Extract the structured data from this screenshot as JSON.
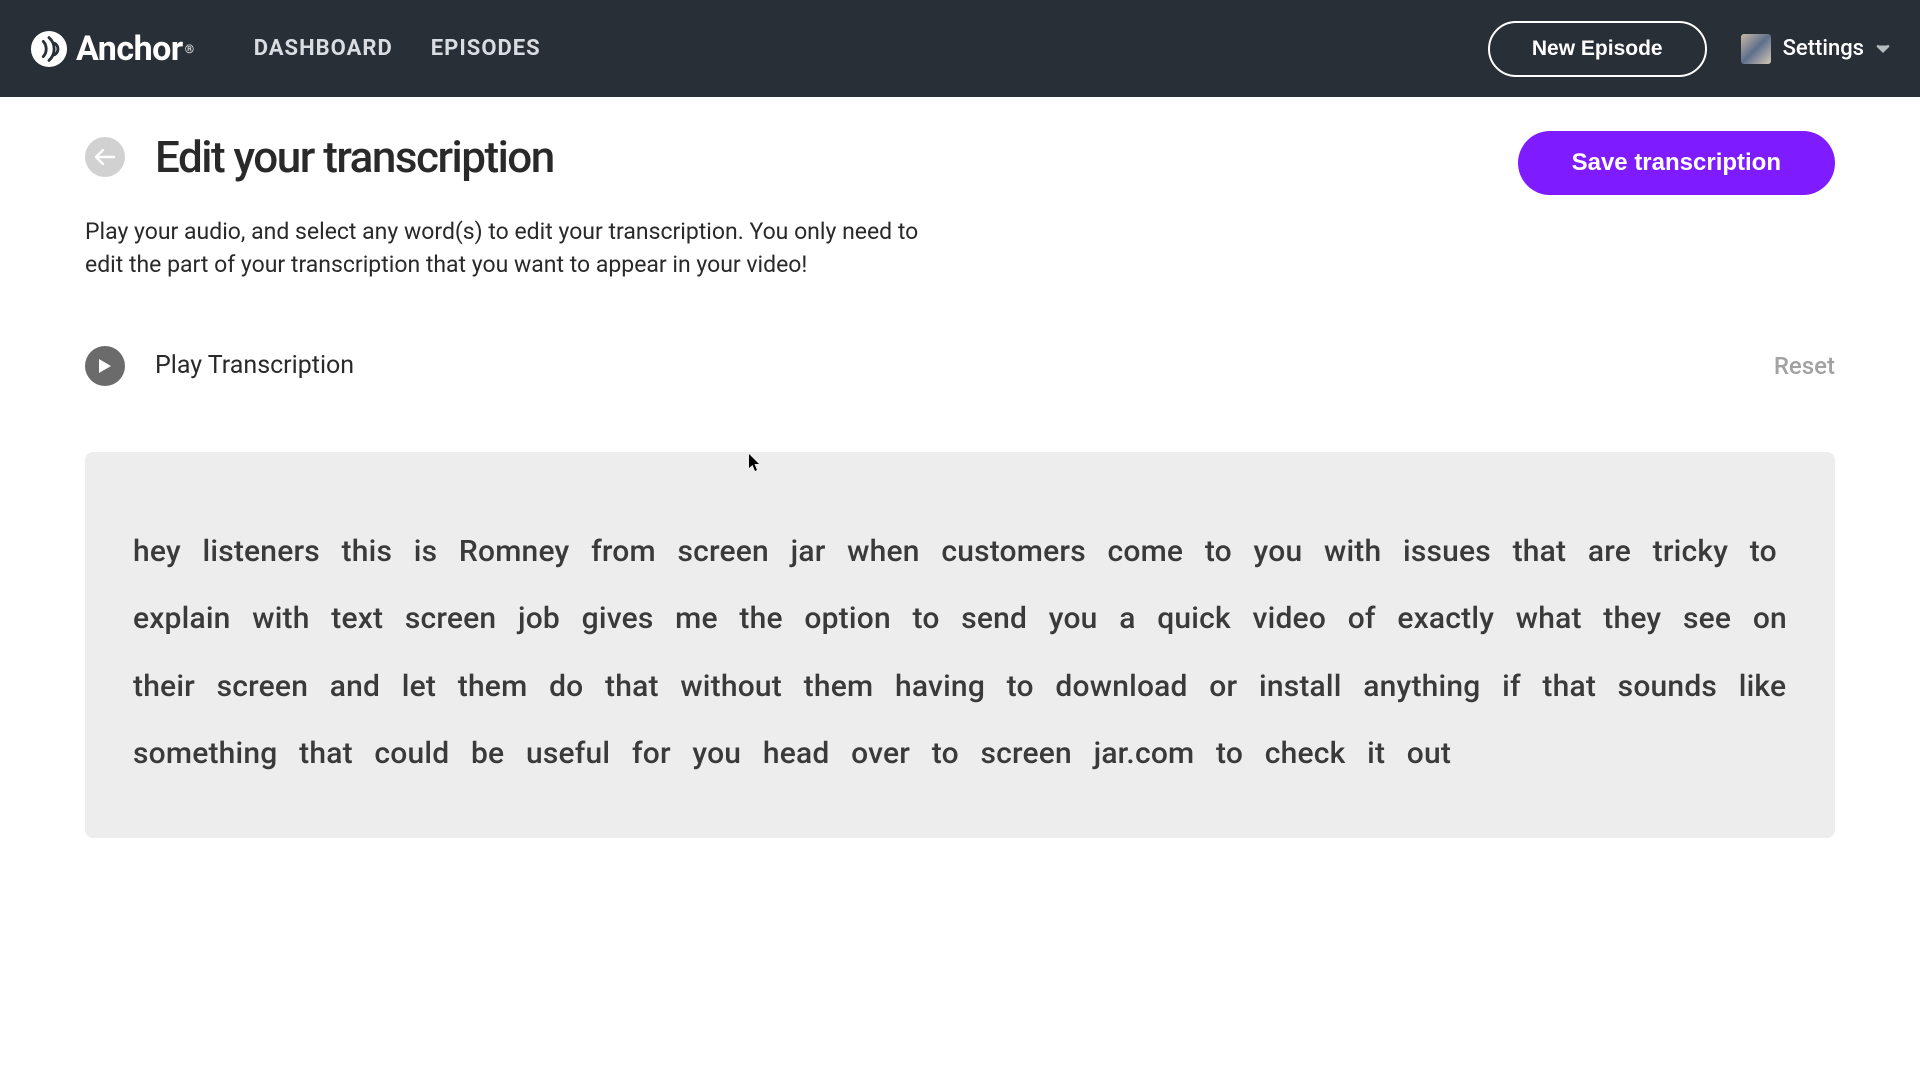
{
  "header": {
    "brand": "Anchor",
    "nav": {
      "dashboard": "DASHBOARD",
      "episodes": "EPISODES"
    },
    "new_episode": "New Episode",
    "settings": "Settings"
  },
  "page": {
    "title": "Edit your transcription",
    "subtitle": "Play your audio, and select any word(s) to edit your transcription. You only need to edit the part of your transcription that you want to appear in your video!",
    "save_button": "Save transcription",
    "play_label": "Play Transcription",
    "reset_label": "Reset",
    "transcription": "hey listeners this is Romney from screen jar when customers come to you with issues that are tricky to explain with text screen job gives me the option to send you a quick video of exactly what they see on their screen and let them do that without them having to download or install anything if that sounds like something that could be useful for you head over to screen jar.com to check it out"
  },
  "colors": {
    "accent": "#7e1cff",
    "topbar": "#282f36"
  }
}
